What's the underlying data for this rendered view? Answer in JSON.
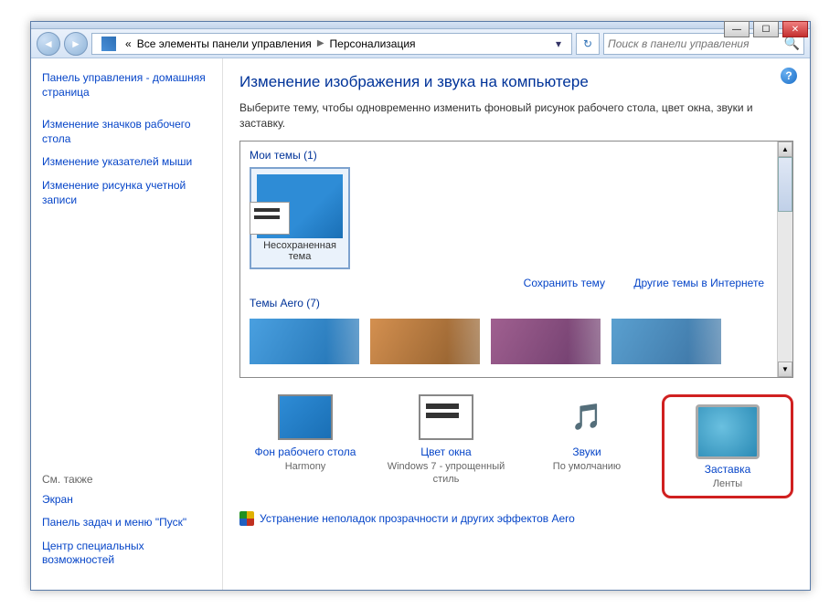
{
  "breadcrumb": {
    "prefix": "«",
    "item1": "Все элементы панели управления",
    "item2": "Персонализация"
  },
  "search": {
    "placeholder": "Поиск в панели управления"
  },
  "sidebar": {
    "home": "Панель управления - домашняя страница",
    "links": [
      "Изменение значков рабочего стола",
      "Изменение указателей мыши",
      "Изменение рисунка учетной записи"
    ],
    "see_also": "См. также",
    "see_also_links": [
      "Экран",
      "Панель задач и меню \"Пуск\"",
      "Центр специальных возможностей"
    ]
  },
  "main": {
    "title": "Изменение изображения и звука на компьютере",
    "desc": "Выберите тему, чтобы одновременно изменить фоновый рисунок рабочего стола, цвет окна, звуки и заставку.",
    "my_themes": "Мои темы (1)",
    "unsaved_theme": "Несохраненная тема",
    "save_theme": "Сохранить тему",
    "more_themes": "Другие темы в Интернете",
    "aero_themes": "Темы Aero (7)"
  },
  "bottom": {
    "bg": {
      "title": "Фон рабочего стола",
      "sub": "Harmony"
    },
    "color": {
      "title": "Цвет окна",
      "sub": "Windows 7 - упрощенный стиль"
    },
    "sounds": {
      "title": "Звуки",
      "sub": "По умолчанию"
    },
    "saver": {
      "title": "Заставка",
      "sub": "Ленты"
    }
  },
  "troubleshoot": "Устранение неполадок прозрачности и других эффектов Aero"
}
